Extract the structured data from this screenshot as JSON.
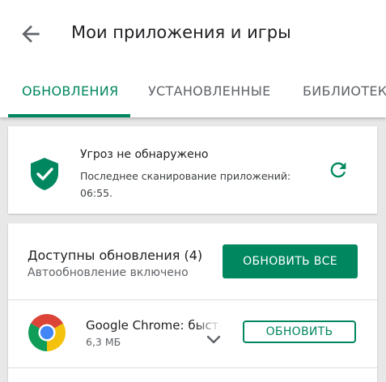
{
  "header": {
    "title": "Мои приложения и игры",
    "back_icon": "arrow-back-icon"
  },
  "tabs": [
    {
      "label": "ОБНОВЛЕНИЯ",
      "active": true
    },
    {
      "label": "УСТАНОВЛЕННЫЕ",
      "active": false
    },
    {
      "label": "БИБЛИОТЕКА",
      "active": false
    }
  ],
  "security": {
    "title": "Угроз не обнаружено",
    "subtitle": "Последнее сканирование приложений: 06:55.",
    "icon": "shield-check-icon",
    "refresh_icon": "refresh-icon"
  },
  "updates": {
    "title": "Доступны обновления (4)",
    "subtitle": "Автообновление включено",
    "update_all_label": "ОБНОВИТЬ ВСЕ"
  },
  "apps": [
    {
      "name": "Google Chrome: быстрый браузер",
      "size": "6,3 МБ",
      "update_label": "ОБНОВИТЬ",
      "icon": "chrome-icon"
    }
  ],
  "colors": {
    "accent": "#01875f",
    "background": "#e8e8e8",
    "card": "#ffffff"
  }
}
